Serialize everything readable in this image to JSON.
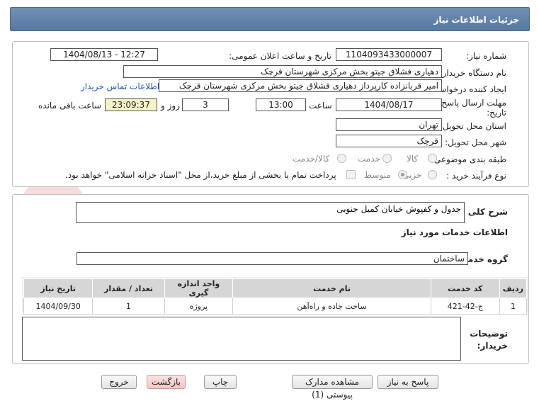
{
  "header": {
    "title": "جزئیات اطلاعات نیاز"
  },
  "form": {
    "need_number_label": "شماره نیاز:",
    "need_number": "1104093433000007",
    "announce_label": "تاریخ و ساعت اعلان عمومی:",
    "announce_value": "1404/08/13 - 12:27",
    "buyer_org_label": "نام دستگاه خریدار:",
    "buyer_org": "دهیاری قشلاق جیتو بخش مرکزی شهرستان قرچک",
    "creator_label": "ایجاد کننده درخواست:",
    "creator": "امیر قربانزاده کارپرداز دهیاری قشلاق جیتو بخش مرکزی شهرستان قرچک",
    "contact_link": "اطلاعات تماس خریدار",
    "deadline_label_1": "مهلت ارسال پاسخ: تا",
    "deadline_label_2": "تاریخ:",
    "deadline_date": "1404/08/17",
    "time_label": "ساعت",
    "deadline_time": "13:00",
    "days_value": "3",
    "days_label": "روز و",
    "remaining_time": "23:09:37",
    "remaining_label": "ساعت باقی مانده",
    "province_label": "استان محل تحویل:",
    "province": "تهران",
    "city_label": "شهر محل تحویل:",
    "city": "قرچک",
    "category_label": "طبقه بندی موضوعی:",
    "category_options": [
      "کالا",
      "خدمت",
      "کالا/خدمت"
    ],
    "process_label": "نوع فرآیند خرید :",
    "process_options": [
      "جزیی",
      "متوسط"
    ],
    "payment_note": "پرداخت تمام یا بخشی از مبلغ خرید،از محل \"اسناد خزانه اسلامی\" خواهد بود."
  },
  "details": {
    "summary_label": "شرح کلی نیاز:",
    "summary": "جدول و کفپوش خیابان کمیل جنوبی",
    "services_title": "اطلاعات خدمات مورد نیاز",
    "group_label": "گروه خدمت:",
    "group_value": "ساختمان",
    "table": {
      "headers": [
        "ردیف",
        "کد خدمت",
        "نام خدمت",
        "واحد اندازه گیری",
        "تعداد / مقدار",
        "تاریخ نیاز"
      ],
      "rows": [
        [
          "1",
          "ج-42-421",
          "ساخت جاده و راه‌آهن",
          "پروژه",
          "1",
          "1404/09/30"
        ]
      ]
    },
    "buyer_notes_label_1": "توضیحات",
    "buyer_notes_label_2": "خریدار:"
  },
  "buttons": {
    "reply": "پاسخ به نیاز",
    "attachments": "مشاهده مدارک پیوستی (1)",
    "print": "چاپ",
    "back": "بازگشت",
    "exit": "خروج"
  },
  "watermark": {
    "text": "AriaTender.net"
  },
  "colors": {
    "header": "#6484ab",
    "link": "#1a55b8",
    "remaining_bg": "#f6f3c8",
    "exit_button": "#f3c4c4"
  }
}
